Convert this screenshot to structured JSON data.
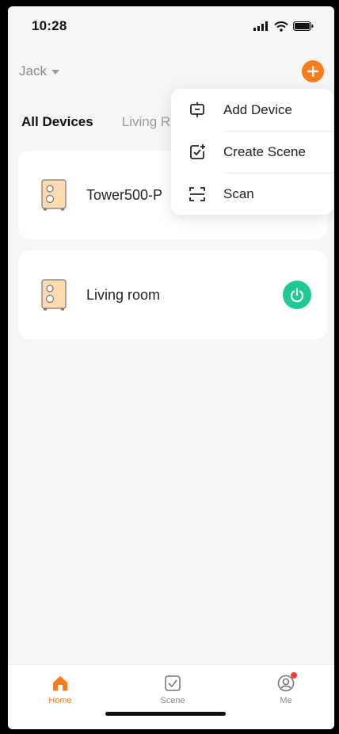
{
  "status_bar": {
    "time": "10:28"
  },
  "header": {
    "home_name": "Jack"
  },
  "tabs": {
    "all": "All Devices",
    "living": "Living R"
  },
  "devices": [
    {
      "name": "Tower500-P",
      "icon": "speaker-icon"
    },
    {
      "name": "Living room",
      "icon": "speaker-icon",
      "power": "on"
    }
  ],
  "menu": {
    "add_device": "Add Device",
    "create_scene": "Create Scene",
    "scan": "Scan"
  },
  "tabbar": {
    "home": "Home",
    "scene": "Scene",
    "me": "Me"
  },
  "colors": {
    "accent": "#ff7a1a",
    "power_on": "#1ec994",
    "badge": "#ff3b30"
  }
}
